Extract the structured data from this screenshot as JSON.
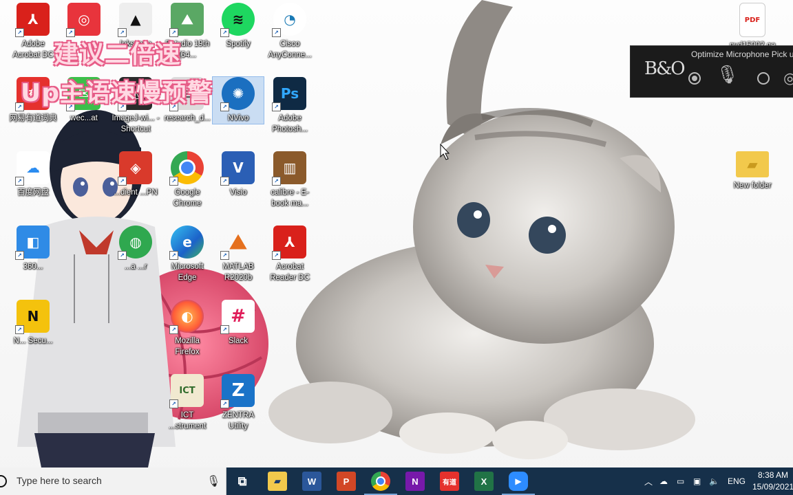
{
  "overlay": {
    "line1": "建议二倍速",
    "line2": "Up主语速慢预警"
  },
  "desktop": {
    "icons": [
      {
        "label": "Adobe Acrobat DC",
        "color": "#d9211b",
        "glyph": "⅄"
      },
      {
        "label": "",
        "color": "#e8343c",
        "glyph": "◎"
      },
      {
        "label": "Inkscape",
        "color": "#eeeeee",
        "glyph": "▲"
      },
      {
        "label": "Rstudio 19th (64...",
        "color": "#5aa864",
        "glyph": "⛰"
      },
      {
        "label": "Spotify",
        "color": "#1ed760",
        "glyph": "≋"
      },
      {
        "label": "Cisco AnyConne...",
        "color": "#ffffff",
        "glyph": "◔"
      },
      {
        "label": "网易有道词典",
        "color": "#e5312d",
        "glyph": "有"
      },
      {
        "label": "wec...at",
        "color": "#3cbf4a",
        "glyph": "✉"
      },
      {
        "label": "ImageJ-wi... - Shortcut",
        "color": "#2b2b2b",
        "glyph": "🔬"
      },
      {
        "label": "research_d...",
        "color": "#dcdcdc",
        "glyph": "≡"
      },
      {
        "label": "NVivo",
        "color": "#1b6fc0",
        "glyph": "✺"
      },
      {
        "label": "Adobe Photosh...",
        "color": "#0f2a44",
        "glyph": "Ps"
      },
      {
        "label": "百度网盘",
        "color": "#2b8cf0",
        "glyph": "☁"
      },
      {
        "label": "...dient ...PN",
        "color": "#d93a2b",
        "glyph": "◈"
      },
      {
        "label": "Google Chrome",
        "color": "#ffffff",
        "glyph": "◉"
      },
      {
        "label": "Visio",
        "color": "#2b5fb5",
        "glyph": "V"
      },
      {
        "label": "calibre - E-book ma...",
        "color": "#8b5a2b",
        "glyph": "▥"
      },
      {
        "label": "360...",
        "color": "#2f8be6",
        "glyph": "◧"
      },
      {
        "label": "...a ...r",
        "color": "#2fa84f",
        "glyph": "◍"
      },
      {
        "label": "Microsoft Edge",
        "color": "#1c8be0",
        "glyph": "e"
      },
      {
        "label": "MATLAB R2020b",
        "color": "#ffffff",
        "glyph": "⛰"
      },
      {
        "label": "Acrobat Reader DC",
        "color": "#d9211b",
        "glyph": "⅄"
      },
      {
        "label": "N... Secu...",
        "color": "#f4c20d",
        "glyph": "N"
      },
      {
        "label": "Mozilla Firefox",
        "color": "#ff8a1f",
        "glyph": "🦊"
      },
      {
        "label": "Slack",
        "color": "#ffffff",
        "glyph": "#"
      },
      {
        "label": "ICT ...strument",
        "color": "#f1e9d0",
        "glyph": "ICT"
      },
      {
        "label": "ZENTRA Utility",
        "color": "#1a73c8",
        "glyph": "Z"
      },
      {
        "label": "pvd15002.ge",
        "color": "#ffffff",
        "glyph": "PDF"
      },
      {
        "label": "New folder",
        "color": "#f2c94c",
        "glyph": "▰"
      }
    ]
  },
  "bo_panel": {
    "logo": "B&O",
    "title": "Optimize Microphone Pick u"
  },
  "taskbar": {
    "search_placeholder": "Type here to search",
    "apps": [
      {
        "name": "task-view",
        "glyph": "⧉",
        "color": "transparent"
      },
      {
        "name": "file-explorer",
        "glyph": "▰",
        "color": "#f2c94c"
      },
      {
        "name": "word",
        "glyph": "W",
        "color": "#2b579a"
      },
      {
        "name": "powerpoint",
        "glyph": "P",
        "color": "#d24726"
      },
      {
        "name": "chrome",
        "glyph": "◉",
        "color": "#e94235"
      },
      {
        "name": "onenote",
        "glyph": "N",
        "color": "#7719aa"
      },
      {
        "name": "youdao",
        "glyph": "有道",
        "color": "#e5312d"
      },
      {
        "name": "excel",
        "glyph": "X",
        "color": "#217346"
      },
      {
        "name": "zoom",
        "glyph": "▶",
        "color": "#2d8cff"
      }
    ],
    "language": "ENG",
    "time": "8:38 AM",
    "date": "15/09/2021"
  }
}
